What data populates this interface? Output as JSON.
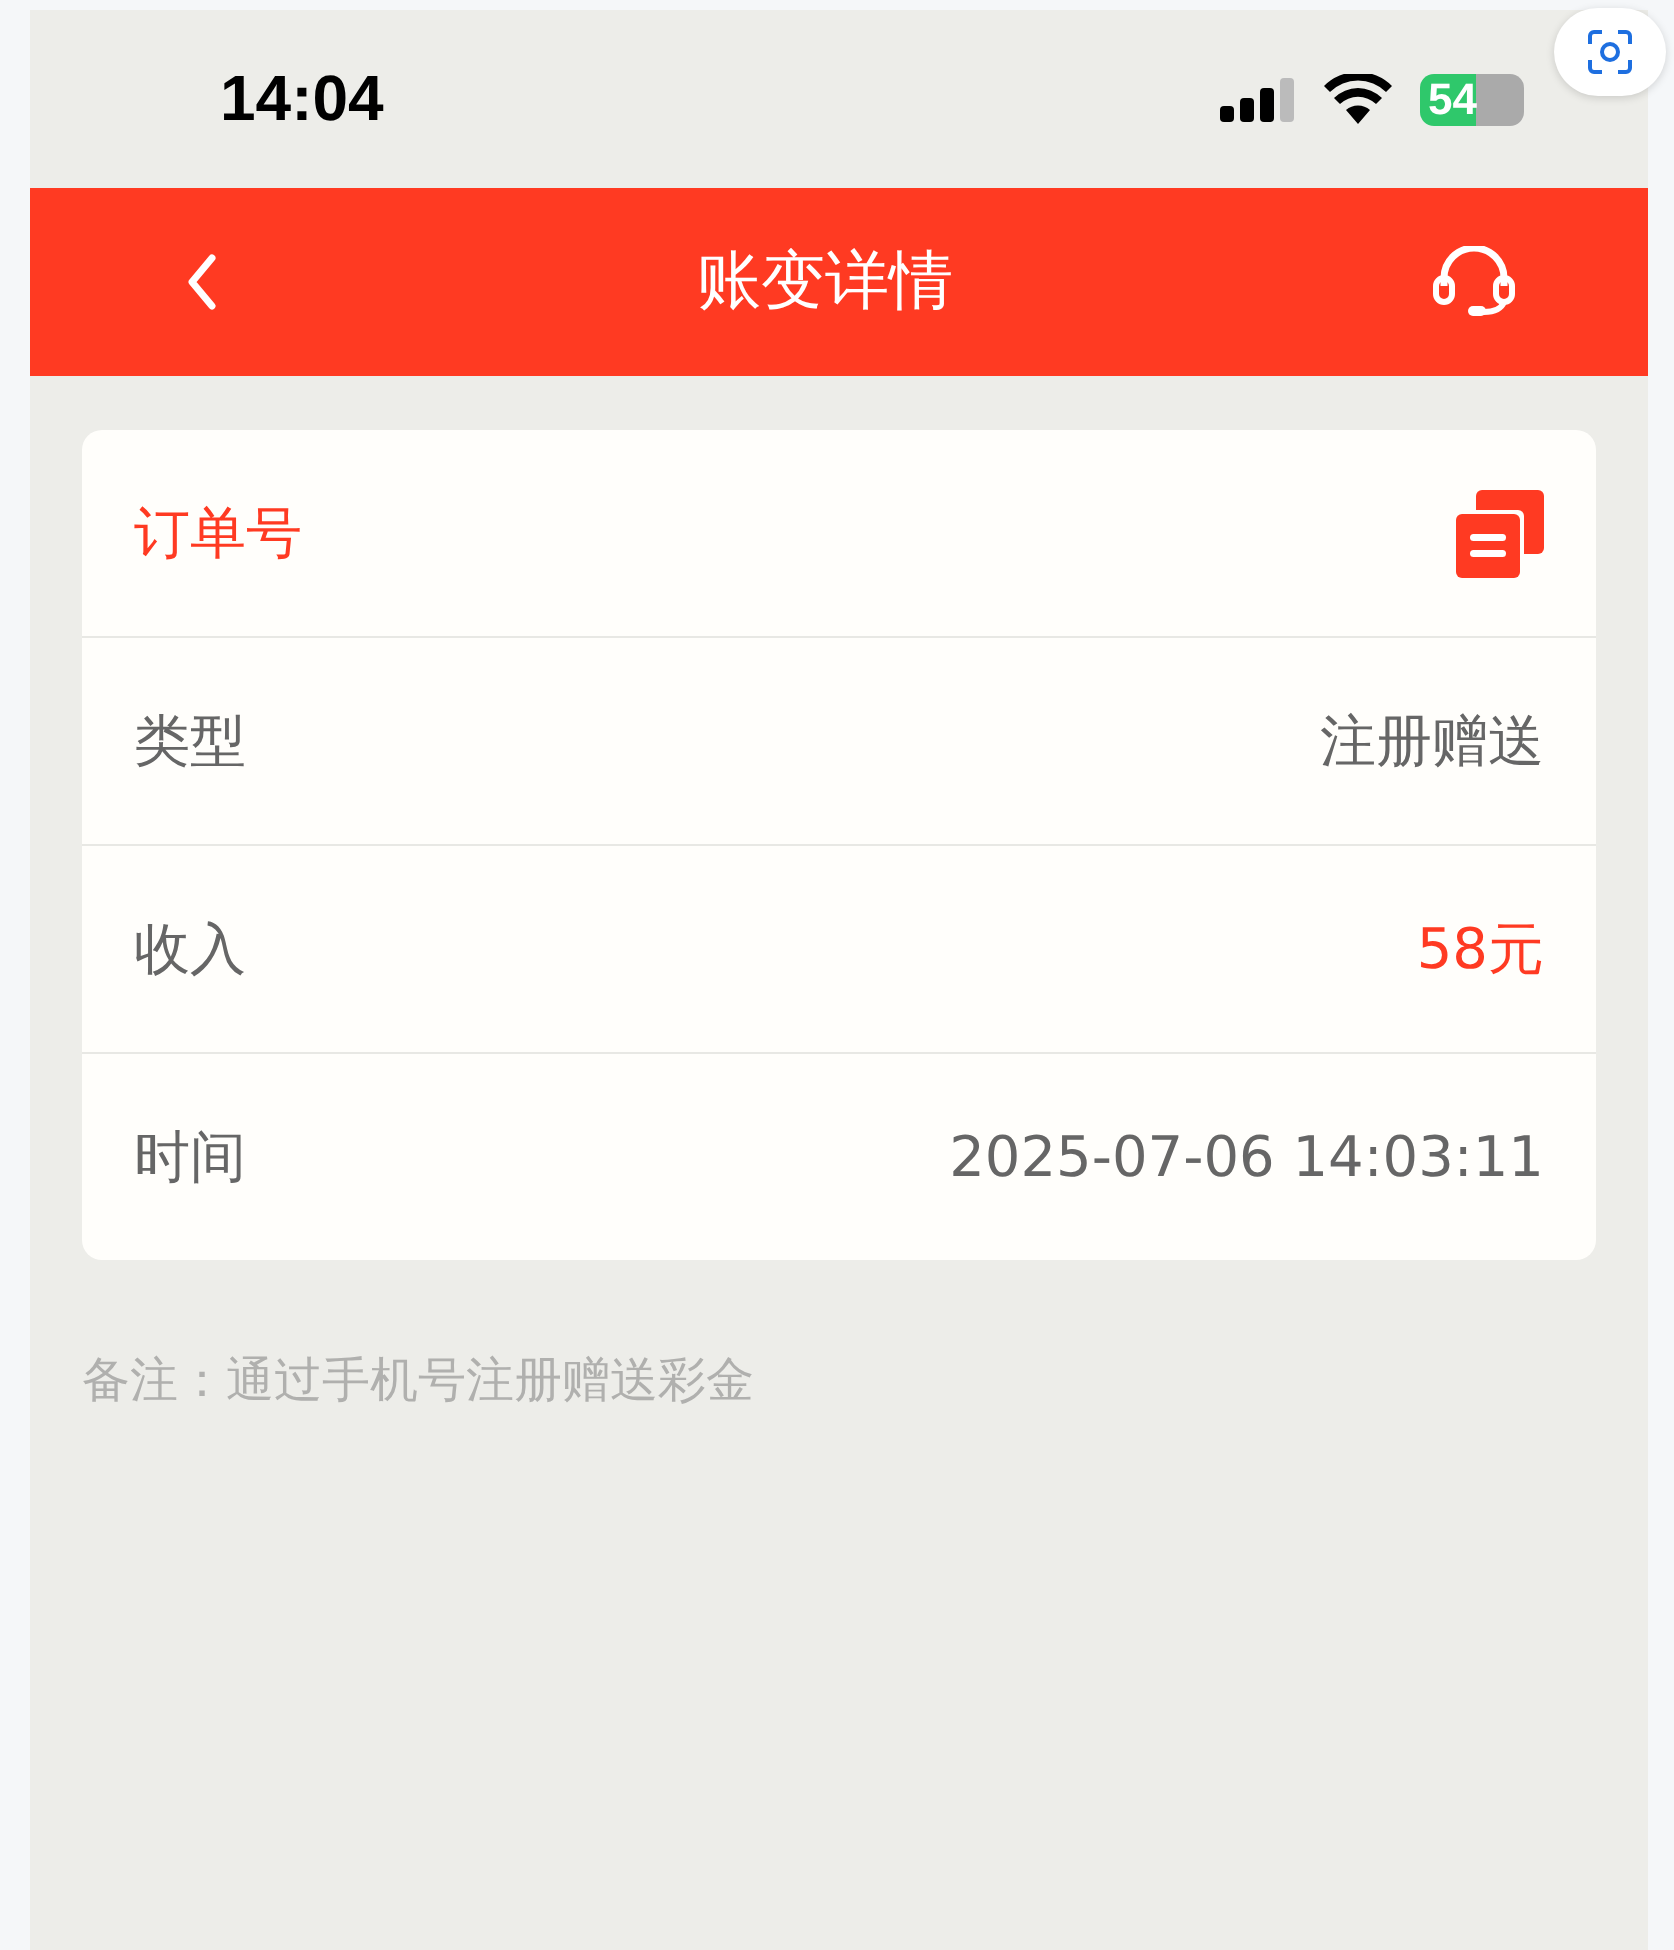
{
  "status_bar": {
    "time": "14:04",
    "battery": "54"
  },
  "header": {
    "title": "账变详情"
  },
  "rows": [
    {
      "kind": "copy",
      "label": "订单号"
    },
    {
      "kind": "text",
      "label": "类型",
      "value": "注册赠送",
      "highlighted": false
    },
    {
      "kind": "text",
      "label": "收入",
      "value": "58元",
      "highlighted": true
    },
    {
      "kind": "text",
      "label": "时间",
      "value": "2025-07-06 14:03:11",
      "highlighted": false
    }
  ],
  "note": "备注：通过手机号注册赠送彩金"
}
